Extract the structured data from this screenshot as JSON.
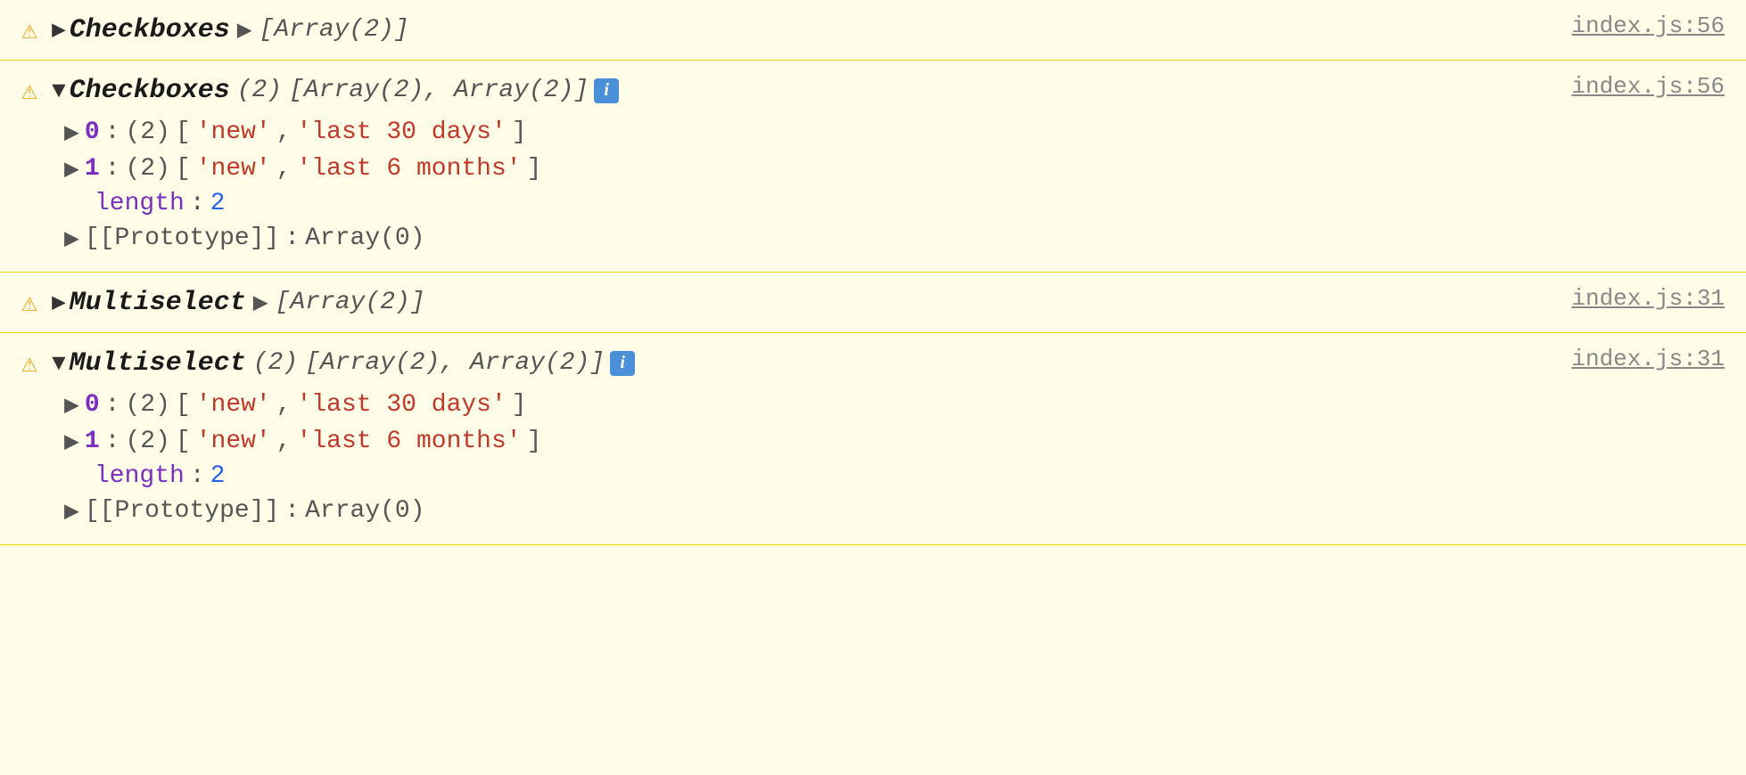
{
  "rows": [
    {
      "id": "row1",
      "warning": "⚠",
      "label": "Checkboxes",
      "expanded": false,
      "arrow": "▶",
      "array_preview": "[Array(2)]",
      "file_link": "index.js:56",
      "children": null
    },
    {
      "id": "row2",
      "warning": "⚠",
      "label": "Checkboxes",
      "expanded": true,
      "arrow": "▼",
      "array_count": "(2)",
      "array_bracket_open": "[Array(2), Array(2)]",
      "has_info": true,
      "info_label": "i",
      "file_link": "index.js:56",
      "children": {
        "items": [
          {
            "index": "0",
            "count": "(2)",
            "values": [
              "'new'",
              "'last 30 days'"
            ]
          },
          {
            "index": "1",
            "count": "(2)",
            "values": [
              "'new'",
              "'last 6 months'"
            ]
          }
        ],
        "length_label": "length",
        "length_value": "2",
        "prototype_label": "[[Prototype]]",
        "prototype_value": "Array(0)"
      }
    },
    {
      "id": "row3",
      "warning": "⚠",
      "label": "Multiselect",
      "expanded": false,
      "arrow": "▶",
      "array_preview": "[Array(2)]",
      "file_link": "index.js:31",
      "children": null
    },
    {
      "id": "row4",
      "warning": "⚠",
      "label": "Multiselect",
      "expanded": true,
      "arrow": "▼",
      "array_count": "(2)",
      "array_bracket_open": "[Array(2), Array(2)]",
      "has_info": true,
      "info_label": "i",
      "file_link": "index.js:31",
      "children": {
        "items": [
          {
            "index": "0",
            "count": "(2)",
            "values": [
              "'new'",
              "'last 30 days'"
            ]
          },
          {
            "index": "1",
            "count": "(2)",
            "values": [
              "'new'",
              "'last 6 months'"
            ]
          }
        ],
        "length_label": "length",
        "length_value": "2",
        "prototype_label": "[[Prototype]]",
        "prototype_value": "Array(0)"
      }
    }
  ]
}
